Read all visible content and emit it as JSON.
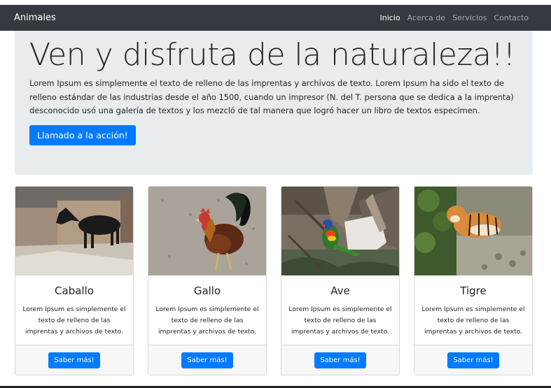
{
  "navbar": {
    "brand": "Animales",
    "links": [
      {
        "label": "Inicio",
        "active": true
      },
      {
        "label": "Acerca de",
        "active": false
      },
      {
        "label": "Servicios",
        "active": false
      },
      {
        "label": "Contacto",
        "active": false
      }
    ]
  },
  "hero": {
    "title": "Ven y disfruta de la naturaleza!!",
    "text": "Lorem Ipsum es simplemente el texto de relleno de las imprentas y archivos de texto. Lorem Ipsum ha sido el texto de relleno estándar de las industrias desde el año 1500, cuando un impresor (N. del T. persona que se dedica a la imprenta) desconocido usó una galería de textos y los mezcló de tal manera que logró hacer un libro de textos especimen.",
    "cta_label": "Llamado a la acción!"
  },
  "cards": [
    {
      "title": "Caballo",
      "text": "Lorem Ipsum es simplemente el texto de relleno de las imprentas y archivos de texto.",
      "button": "Saber más!",
      "image": "horse-photo"
    },
    {
      "title": "Gallo",
      "text": "Lorem Ipsum es simplemente el texto de relleno de las imprentas y archivos de texto.",
      "button": "Saber más!",
      "image": "rooster-photo"
    },
    {
      "title": "Ave",
      "text": "Lorem Ipsum es simplemente el texto de relleno de las imprentas y archivos de texto.",
      "button": "Saber más!",
      "image": "parrot-photo"
    },
    {
      "title": "Tigre",
      "text": "Lorem Ipsum es simplemente el texto de relleno de las imprentas y archivos de texto.",
      "button": "Saber más!",
      "image": "tiger-photo"
    }
  ],
  "colors": {
    "navbar": "#343a40",
    "jumbotron": "#e9ecef",
    "primary": "#007bff"
  }
}
